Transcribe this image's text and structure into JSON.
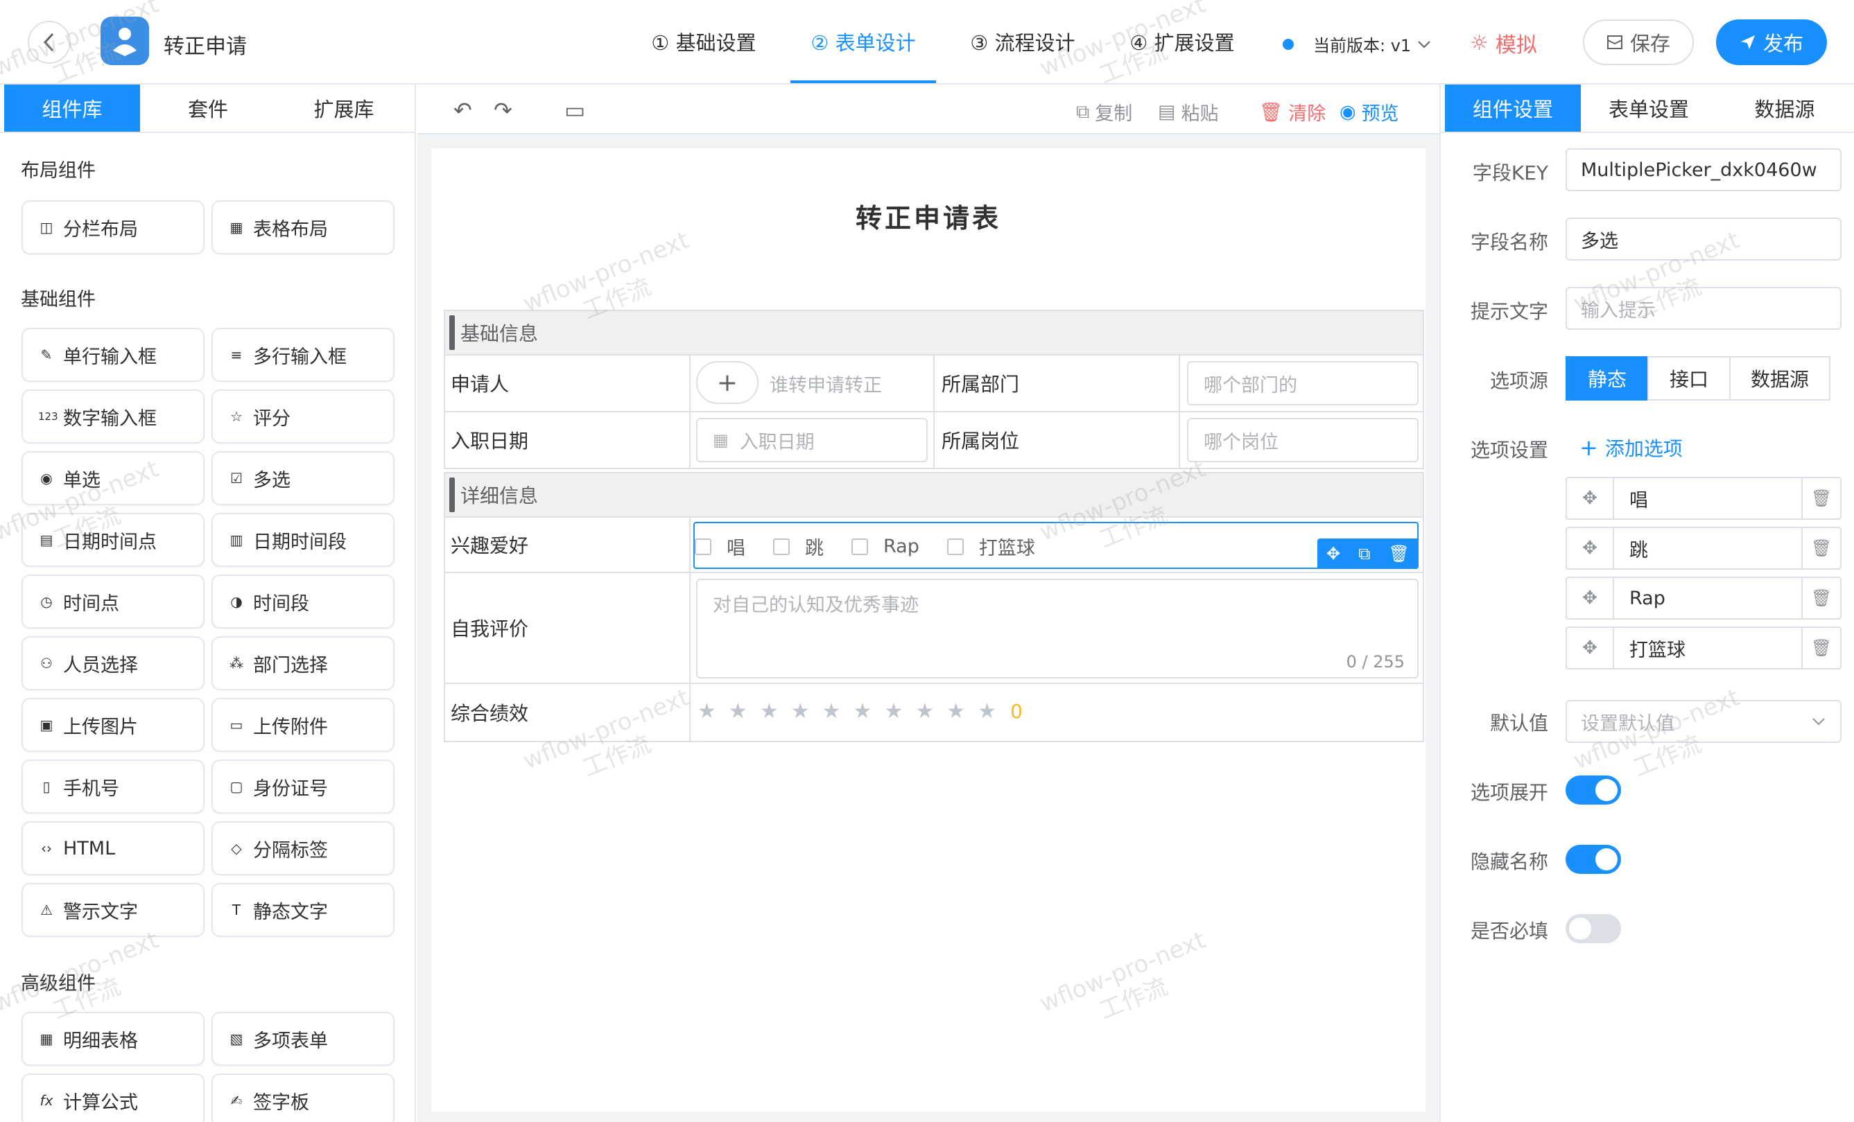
{
  "header": {
    "app_title": "转正申请",
    "steps": [
      "① 基础设置",
      "② 表单设计",
      "③ 流程设计",
      "④ 扩展设置"
    ],
    "active_step": 1,
    "version_label": "当前版本: v1",
    "simulate_label": "模拟",
    "save_label": "保存",
    "publish_label": "发布"
  },
  "left": {
    "tabs": [
      "组件库",
      "套件",
      "扩展库"
    ],
    "groups": {
      "layout": "布局组件",
      "basic": "基础组件",
      "advanced": "高级组件"
    },
    "layout_items": [
      {
        "icon": "columns-icon",
        "label": "分栏布局"
      },
      {
        "icon": "table-layout-icon",
        "label": "表格布局"
      }
    ],
    "basic_items": [
      {
        "icon": "pen-icon",
        "label": "单行输入框"
      },
      {
        "icon": "multiline-icon",
        "label": "多行输入框"
      },
      {
        "icon": "number-icon",
        "label": "数字输入框"
      },
      {
        "icon": "star-icon",
        "label": "评分"
      },
      {
        "icon": "radio-icon",
        "label": "单选"
      },
      {
        "icon": "checkbox-icon",
        "label": "多选"
      },
      {
        "icon": "calendar-icon",
        "label": "日期时间点"
      },
      {
        "icon": "calendar-range-icon",
        "label": "日期时间段"
      },
      {
        "icon": "clock-icon",
        "label": "时间点"
      },
      {
        "icon": "clock-range-icon",
        "label": "时间段"
      },
      {
        "icon": "users-icon",
        "label": "人员选择"
      },
      {
        "icon": "org-icon",
        "label": "部门选择"
      },
      {
        "icon": "image-icon",
        "label": "上传图片"
      },
      {
        "icon": "folder-icon",
        "label": "上传附件"
      },
      {
        "icon": "phone-icon",
        "label": "手机号"
      },
      {
        "icon": "id-card-icon",
        "label": "身份证号"
      },
      {
        "icon": "code-icon",
        "label": "HTML"
      },
      {
        "icon": "tag-icon",
        "label": "分隔标签"
      },
      {
        "icon": "warning-icon",
        "label": "警示文字"
      },
      {
        "icon": "text-icon",
        "label": "静态文字"
      }
    ],
    "advanced_items": [
      {
        "icon": "detail-table-icon",
        "label": "明细表格"
      },
      {
        "icon": "multi-form-icon",
        "label": "多项表单"
      },
      {
        "icon": "formula-icon",
        "label": "计算公式"
      },
      {
        "icon": "signature-icon",
        "label": "签字板"
      }
    ]
  },
  "toolbar": {
    "copy_label": "复制",
    "paste_label": "粘贴",
    "clear_label": "清除",
    "preview_label": "预览"
  },
  "form": {
    "title": "转正申请表",
    "section_basic": "基础信息",
    "section_detail": "详细信息",
    "applicant_label": "申请人",
    "applicant_placeholder": "谁转申请转正",
    "dept_label": "所属部门",
    "dept_placeholder": "哪个部门的",
    "join_date_label": "入职日期",
    "join_date_placeholder": "入职日期",
    "position_label": "所属岗位",
    "position_placeholder": "哪个岗位",
    "hobby_label": "兴趣爱好",
    "hobby_options": [
      "唱",
      "跳",
      "Rap",
      "打篮球"
    ],
    "self_eval_label": "自我评价",
    "self_eval_placeholder": "对自己的认知及优秀事迹",
    "self_eval_counter": "0 / 255",
    "perf_label": "综合绩效",
    "perf_star_count": 10,
    "perf_value": "0"
  },
  "right": {
    "tabs": [
      "组件设置",
      "表单设置",
      "数据源"
    ],
    "field_key_label": "字段KEY",
    "field_key_value": "MultiplePicker_dxk0460w",
    "field_name_label": "字段名称",
    "field_name_value": "多选",
    "hint_label": "提示文字",
    "hint_placeholder": "输入提示",
    "source_label": "选项源",
    "source_options": [
      "静态",
      "接口",
      "数据源"
    ],
    "options_label": "选项设置",
    "add_option_label": "添加选项",
    "options": [
      "唱",
      "跳",
      "Rap",
      "打篮球"
    ],
    "default_label": "默认值",
    "default_placeholder": "设置默认值",
    "expand_label": "选项展开",
    "expand_on": true,
    "hide_name_label": "隐藏名称",
    "hide_name_on": true,
    "required_label": "是否必填",
    "required_on": false
  },
  "watermark": [
    "wflow-pro-next",
    "工作流"
  ]
}
